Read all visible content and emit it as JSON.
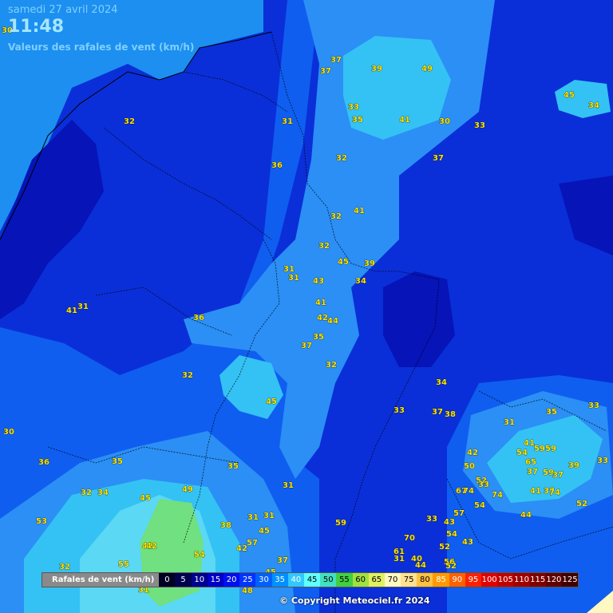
{
  "header": {
    "date": "samedi 27 avril 2024",
    "time": "11:48",
    "subtitle": "Valeurs des rafales de vent (km/h)"
  },
  "legend": {
    "title": "Rafales de vent (km/h)",
    "items": [
      {
        "label": "0",
        "color": "#000022",
        "text": "#ffffff"
      },
      {
        "label": "5",
        "color": "#00004f",
        "text": "#ffffff"
      },
      {
        "label": "10",
        "color": "#00008f",
        "text": "#ffffff"
      },
      {
        "label": "15",
        "color": "#0000c8",
        "text": "#ffffff"
      },
      {
        "label": "20",
        "color": "#0010ee",
        "text": "#ffffff"
      },
      {
        "label": "25",
        "color": "#0034ff",
        "text": "#ffffff"
      },
      {
        "label": "30",
        "color": "#0060ff",
        "text": "#ffffff"
      },
      {
        "label": "35",
        "color": "#0090ff",
        "text": "#ffffff"
      },
      {
        "label": "40",
        "color": "#30c8ff",
        "text": "#ffffff"
      },
      {
        "label": "45",
        "color": "#60ffff",
        "text": "#000000"
      },
      {
        "label": "50",
        "color": "#40e0c0",
        "text": "#000000"
      },
      {
        "label": "55",
        "color": "#40d040",
        "text": "#000000"
      },
      {
        "label": "60",
        "color": "#a0e040",
        "text": "#000000"
      },
      {
        "label": "65",
        "color": "#e0f060",
        "text": "#000000"
      },
      {
        "label": "70",
        "color": "#fff8c0",
        "text": "#000000"
      },
      {
        "label": "75",
        "color": "#ffe090",
        "text": "#000000"
      },
      {
        "label": "80",
        "color": "#ffc040",
        "text": "#000000"
      },
      {
        "label": "85",
        "color": "#ff9a00",
        "text": "#ffffff"
      },
      {
        "label": "90",
        "color": "#ff6000",
        "text": "#ffffff"
      },
      {
        "label": "95",
        "color": "#ff2000",
        "text": "#ffffff"
      },
      {
        "label": "100",
        "color": "#e00000",
        "text": "#ffffff"
      },
      {
        "label": "105",
        "color": "#c00000",
        "text": "#ffffff"
      },
      {
        "label": "110",
        "color": "#a00000",
        "text": "#ffffff"
      },
      {
        "label": "115",
        "color": "#800000",
        "text": "#ffffff"
      },
      {
        "label": "120",
        "color": "#600000",
        "text": "#ffffff"
      },
      {
        "label": "125",
        "color": "#400000",
        "text": "#ffffff"
      }
    ]
  },
  "stations": [
    "30",
    "37",
    "37",
    "39",
    "49",
    "45",
    "34",
    "32",
    "31",
    "33",
    "35",
    "41",
    "30",
    "33",
    "36",
    "32",
    "37",
    "41",
    "32",
    "32",
    "45",
    "39",
    "31",
    "31",
    "43",
    "34",
    "41",
    "41",
    "36",
    "42",
    "44",
    "31",
    "37",
    "35",
    "32",
    "32",
    "34",
    "45",
    "37",
    "38",
    "31",
    "35",
    "33",
    "30",
    "33",
    "36",
    "35",
    "42",
    "41",
    "59",
    "50",
    "37",
    "54",
    "65",
    "59",
    "39",
    "33",
    "37",
    "59",
    "52",
    "67",
    "74",
    "41",
    "33",
    "37",
    "32",
    "34",
    "49",
    "35",
    "74",
    "31",
    "45",
    "54",
    "31",
    "74",
    "52",
    "57",
    "33",
    "38",
    "31",
    "59",
    "44",
    "53",
    "43",
    "45",
    "57",
    "70",
    "54",
    "42",
    "42",
    "54",
    "52",
    "61",
    "43",
    "40",
    "56",
    "31",
    "44",
    "32",
    "55",
    "37",
    "45",
    "48",
    "31",
    "42",
    "52"
  ],
  "copyright": "© Copyright Meteociel.fr 2024",
  "colors": {
    "zone_deep": "#0614b8",
    "zone_dark": "#0a2fd8",
    "zone_mid": "#0f5ef0",
    "zone_light": "#2b8ff5",
    "zone_cyan": "#34c2f4",
    "zone_pale": "#5ad8f4",
    "zone_green": "#70e080",
    "sea": "#1c8ff0"
  }
}
